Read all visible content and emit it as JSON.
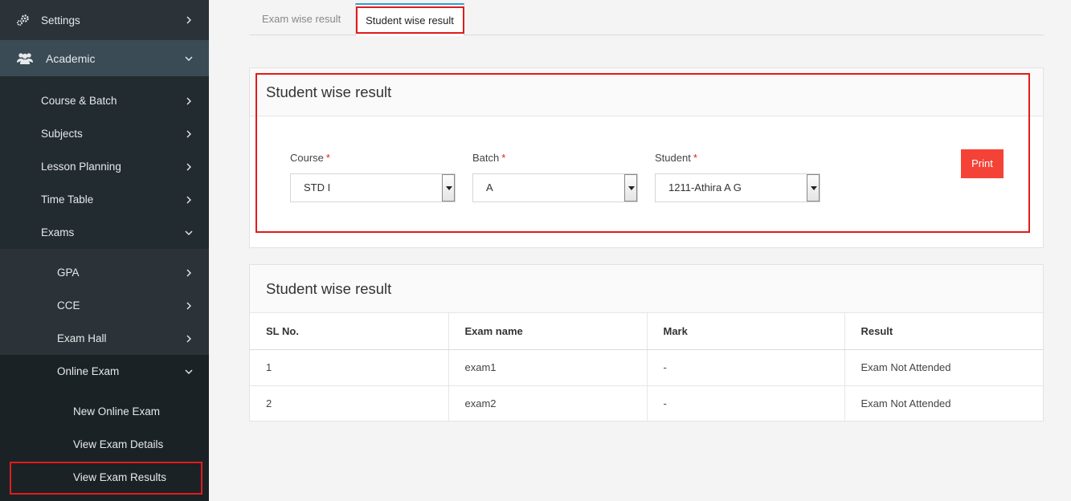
{
  "sidebar": {
    "settings": "Settings",
    "academic": "Academic",
    "items": [
      {
        "label": "Course & Batch"
      },
      {
        "label": "Subjects"
      },
      {
        "label": "Lesson Planning"
      },
      {
        "label": "Time Table"
      }
    ],
    "exams": "Exams",
    "exam_items": [
      {
        "label": "GPA"
      },
      {
        "label": "CCE"
      },
      {
        "label": "Exam Hall"
      }
    ],
    "online_exam": "Online Exam",
    "online_items": [
      {
        "label": "New Online Exam"
      },
      {
        "label": "View Exam Details"
      },
      {
        "label": "View Exam Results"
      }
    ],
    "active_item": "View Exam Results"
  },
  "tabs": [
    {
      "label": "Exam wise result"
    },
    {
      "label": "Student wise result"
    }
  ],
  "active_tab": "Student wise result",
  "form_panel": {
    "title": "Student wise result",
    "course_label": "Course",
    "course_value": "STD I",
    "batch_label": "Batch",
    "batch_value": "A",
    "student_label": "Student",
    "student_value": "1211-Athira A G",
    "required_mark": "*",
    "print_label": "Print"
  },
  "result_panel": {
    "title": "Student wise result",
    "columns": [
      "SL No.",
      "Exam name",
      "Mark",
      "Result"
    ],
    "rows": [
      [
        "1",
        "exam1",
        "-",
        "Exam Not Attended"
      ],
      [
        "2",
        "exam2",
        "-",
        "Exam Not Attended"
      ]
    ]
  },
  "colors": {
    "sidebar_bg": "#2b3338",
    "accent": "#2a9fd6",
    "print_button": "#f44336",
    "highlight": "#e21b1b"
  }
}
